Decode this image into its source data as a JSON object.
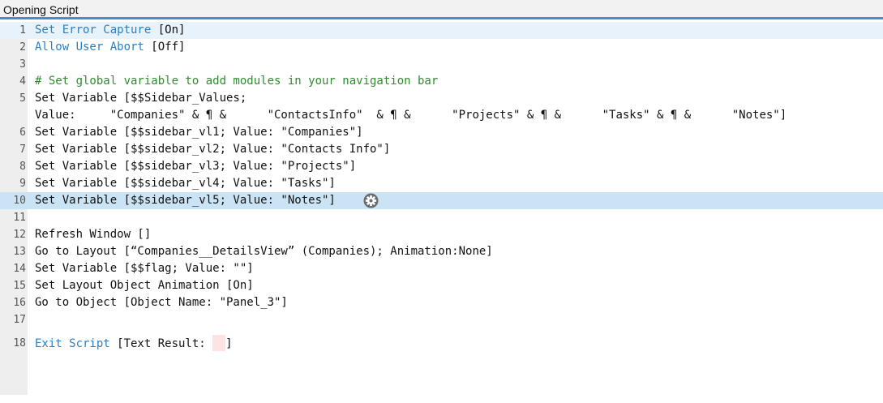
{
  "window": {
    "title": "Opening Script"
  },
  "lines": [
    {
      "n": "1",
      "kw": "Set Error Capture",
      "rest": " [On]"
    },
    {
      "n": "2",
      "kw": "Allow User Abort",
      "rest": " [Off]"
    },
    {
      "n": "3"
    },
    {
      "n": "4",
      "comment": "# Set global variable to add modules in your navigation bar"
    },
    {
      "n": "5",
      "text": "Set Variable [$$Sidebar_Values;"
    },
    {
      "n": "",
      "text": "Value:     \"Companies\" & ¶ &      \"ContactsInfo\"  & ¶ &      \"Projects\" & ¶ &      \"Tasks\" & ¶ &      \"Notes\"]"
    },
    {
      "n": "6",
      "text": "Set Variable [$$sidebar_vl1; Value: \"Companies\"]"
    },
    {
      "n": "7",
      "text": "Set Variable [$$sidebar_vl2; Value: \"Contacts Info\"]"
    },
    {
      "n": "8",
      "text": "Set Variable [$$sidebar_vl3; Value: \"Projects\"]"
    },
    {
      "n": "9",
      "text": "Set Variable [$$sidebar_vl4; Value: \"Tasks\"]"
    },
    {
      "n": "10",
      "text": "Set Variable [$$sidebar_vl5; Value: \"Notes\"]"
    },
    {
      "n": "11"
    },
    {
      "n": "12",
      "text": "Refresh Window []"
    },
    {
      "n": "13",
      "text": "Go to Layout [“Companies__DetailsView” (Companies); Animation:None]"
    },
    {
      "n": "14",
      "text": "Set Variable [$$flag; Value: \"\"]"
    },
    {
      "n": "15",
      "text": "Set Layout Object Animation [On]"
    },
    {
      "n": "16",
      "text": "Go to Object [Object Name: \"Panel_3\"]"
    },
    {
      "n": "17"
    },
    {
      "n": "18",
      "kw": "Exit Script",
      "rest": " [Text Result: ",
      "tail": "]"
    }
  ],
  "icons": {
    "step_options": "gear-icon"
  }
}
